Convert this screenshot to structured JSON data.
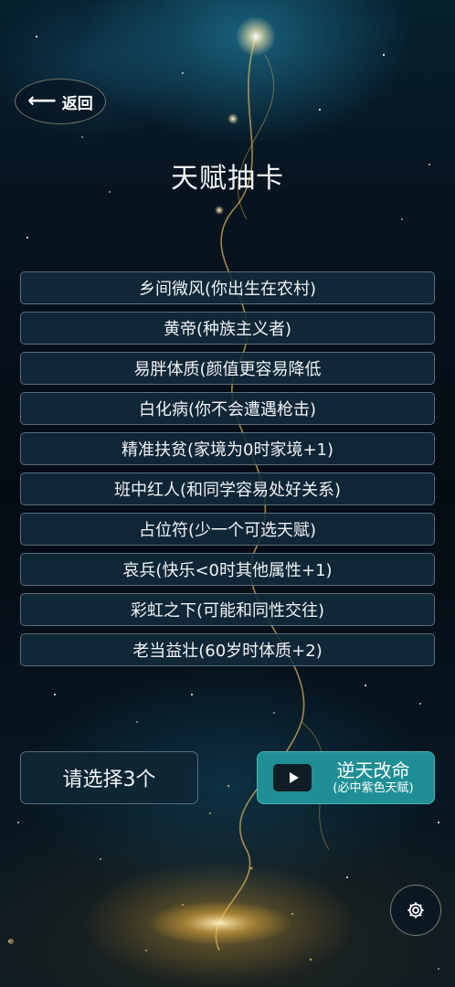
{
  "header": {
    "back_label": "返回",
    "back_icon": "left-arrow-icon",
    "title": "天赋抽卡"
  },
  "talents": [
    {
      "label": "乡间微风(你出生在农村)"
    },
    {
      "label": "黄帝(种族主义者)"
    },
    {
      "label": "易胖体质(颜值更容易降低"
    },
    {
      "label": "白化病(你不会遭遇枪击)"
    },
    {
      "label": "精准扶贫(家境为0时家境+1)"
    },
    {
      "label": "班中红人(和同学容易处好关系)"
    },
    {
      "label": "占位符(少一个可选天赋)"
    },
    {
      "label": "哀兵(快乐<0时其他属性+1)"
    },
    {
      "label": "彩虹之下(可能和同性交往)"
    },
    {
      "label": "老当益壮(60岁时体质+2)"
    }
  ],
  "footer": {
    "select_hint": "请选择3个",
    "reroll_label": "逆天改命",
    "reroll_sub": "(必中紫色天赋)",
    "reroll_icon": "play-video-icon",
    "settings_icon": "gear-icon"
  },
  "colors": {
    "accent": "#1f8f95",
    "card_bg": "#122c3c",
    "glow": "#e0b04a"
  }
}
